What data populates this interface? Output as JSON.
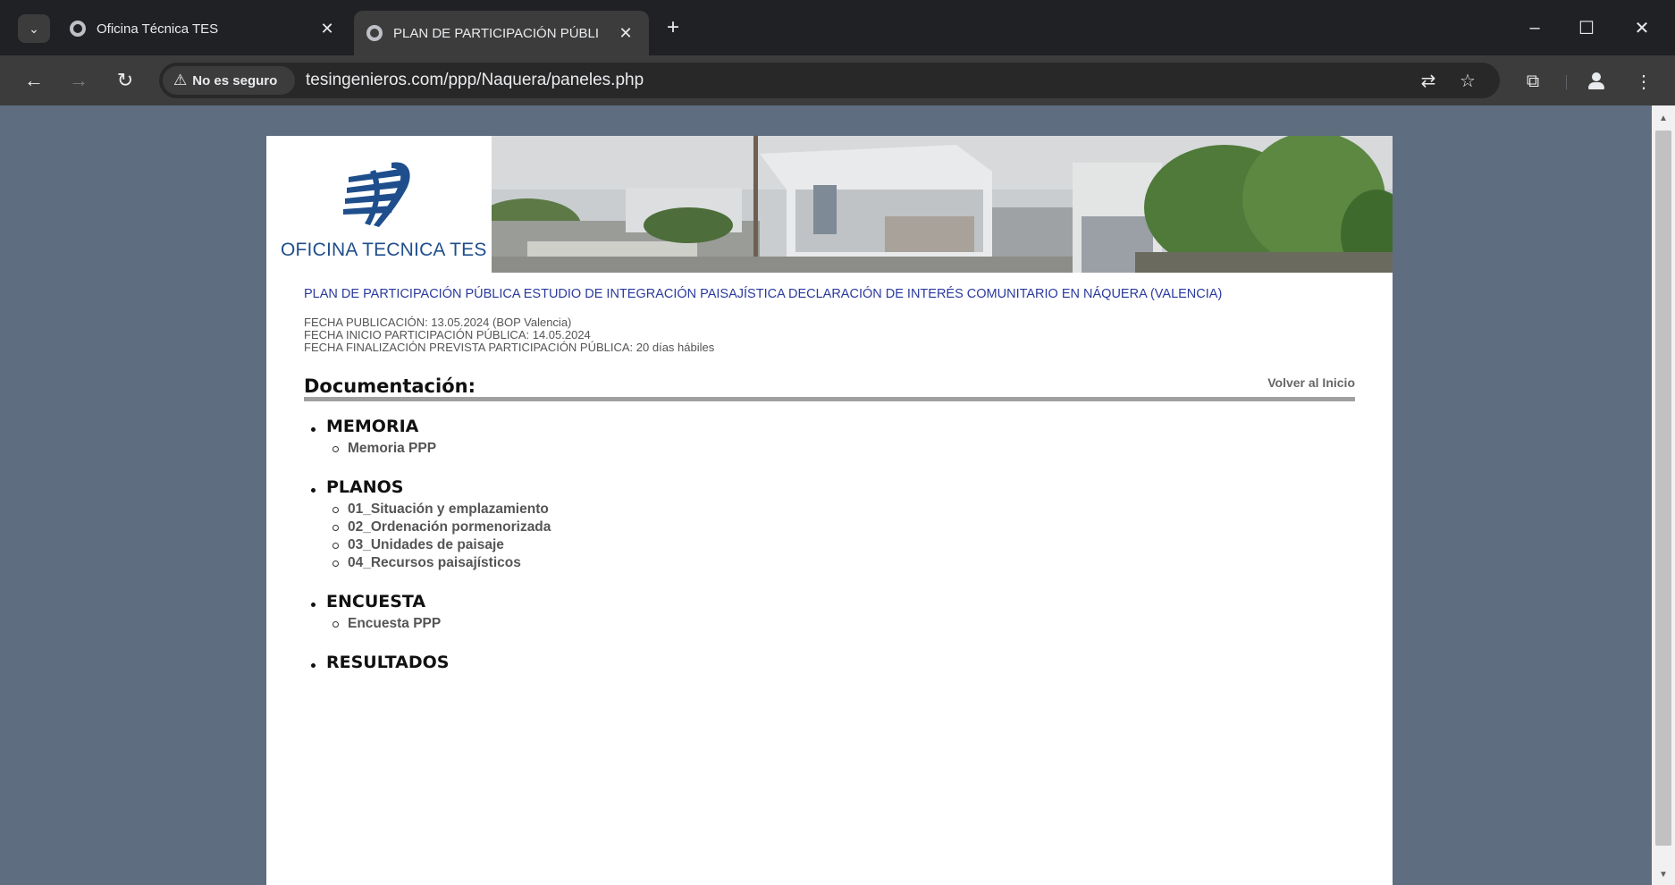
{
  "browser": {
    "tabs": [
      {
        "title": "Oficina Técnica TES",
        "active": false
      },
      {
        "title": "PLAN DE PARTICIPACIÓN PÚBLI",
        "active": true
      }
    ],
    "new_tab_label": "+",
    "security_chip": "No es seguro",
    "url": "tesingenieros.com/ppp/Naquera/paneles.php",
    "icons": {
      "back": "arrow-left-icon",
      "forward": "arrow-right-icon",
      "reload": "reload-icon",
      "translate": "translate-icon",
      "bookmark": "star-icon",
      "extensions": "puzzle-icon",
      "profile": "profile-icon",
      "menu": "kebab-menu-icon"
    }
  },
  "page": {
    "logo_text": "OFICINA TECNICA TES",
    "plan_title": "PLAN DE PARTICIPACIÓN PÚBLICA ESTUDIO DE INTEGRACIÓN PAISAJÍSTICA DECLARACIÓN DE INTERÉS COMUNITARIO EN NÁQUERA (VALENCIA)",
    "dates": [
      "FECHA PUBLICACIÓN: 13.05.2024 (BOP Valencia)",
      "FECHA INICIO PARTICIPACIÓN PÚBLICA: 14.05.2024",
      "FECHA FINALIZACIÓN PREVISTA PARTICIPACIÓN PÚBLICA: 20 días hábiles"
    ],
    "doc_heading": "Documentación:",
    "back_link": "Volver al Inicio",
    "sections": [
      {
        "title": "MEMORIA",
        "items": [
          "Memoria PPP"
        ]
      },
      {
        "title": "PLANOS",
        "items": [
          "01_Situación y emplazamiento",
          "02_Ordenación pormenorizada",
          "03_Unidades de paisaje",
          "04_Recursos paisajísticos"
        ]
      },
      {
        "title": "ENCUESTA",
        "items": [
          "Encuesta PPP"
        ]
      },
      {
        "title": "RESULTADOS",
        "items": []
      }
    ],
    "colors": {
      "title_blue": "#2a3a9e",
      "logo_blue": "#1f4e8c",
      "backdrop": "#5f6d80"
    }
  }
}
